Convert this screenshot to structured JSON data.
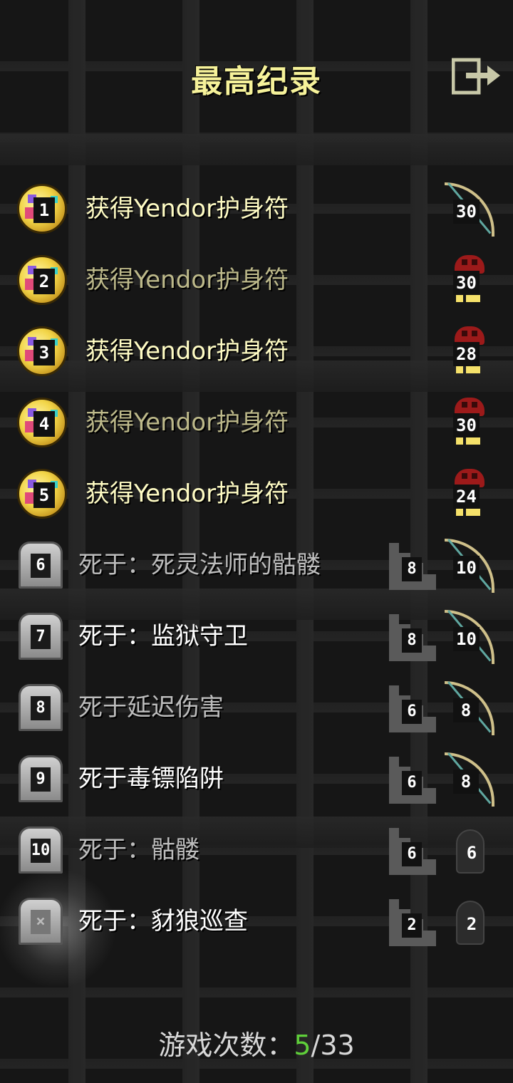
{
  "header": {
    "title": "最高纪录",
    "exit_icon": "exit-icon"
  },
  "records": [
    {
      "rank": "1",
      "status": "win",
      "text": "获得Yendor护身符",
      "class_icon": "bow-icon",
      "level": "30",
      "bright": true
    },
    {
      "rank": "2",
      "status": "win",
      "text": "获得Yendor护身符",
      "class_icon": "red-hood-icon",
      "level": "30",
      "bright": false
    },
    {
      "rank": "3",
      "status": "win",
      "text": "获得Yendor护身符",
      "class_icon": "red-hood-icon",
      "level": "28",
      "bright": true
    },
    {
      "rank": "4",
      "status": "win",
      "text": "获得Yendor护身符",
      "class_icon": "red-hood-icon",
      "level": "30",
      "bright": false
    },
    {
      "rank": "5",
      "status": "win",
      "text": "获得Yendor护身符",
      "class_icon": "red-hood-icon",
      "level": "24",
      "bright": true
    },
    {
      "rank": "6",
      "status": "dead",
      "text": "死于：死灵法师的骷髅",
      "depth": "8",
      "class_icon": "bow-icon",
      "level": "10",
      "bright": false
    },
    {
      "rank": "7",
      "status": "dead",
      "text": "死于：监狱守卫",
      "depth": "8",
      "class_icon": "bow-icon",
      "level": "10",
      "bright": true
    },
    {
      "rank": "8",
      "status": "dead",
      "text": "死于延迟伤害",
      "depth": "6",
      "class_icon": "bow-icon",
      "level": "8",
      "bright": false
    },
    {
      "rank": "9",
      "status": "dead",
      "text": "死于毒镖陷阱",
      "depth": "6",
      "class_icon": "bow-icon",
      "level": "8",
      "bright": true
    },
    {
      "rank": "10",
      "status": "dead",
      "text": "死于：骷髅",
      "depth": "6",
      "class_icon": "ghost-icon",
      "level": "6",
      "bright": false
    },
    {
      "rank": "",
      "status": "dead-latest",
      "text": "死于：豺狼巡查",
      "depth": "2",
      "class_icon": "ghost-icon",
      "level": "2",
      "bright": true
    }
  ],
  "footer": {
    "label": "游戏次数：",
    "current": "5",
    "total": "/33"
  },
  "colors": {
    "title": "#f6f29a",
    "win_bright": "#fffcc4",
    "win_dim": "#bdb98a",
    "count_current": "#5fcf3a"
  }
}
